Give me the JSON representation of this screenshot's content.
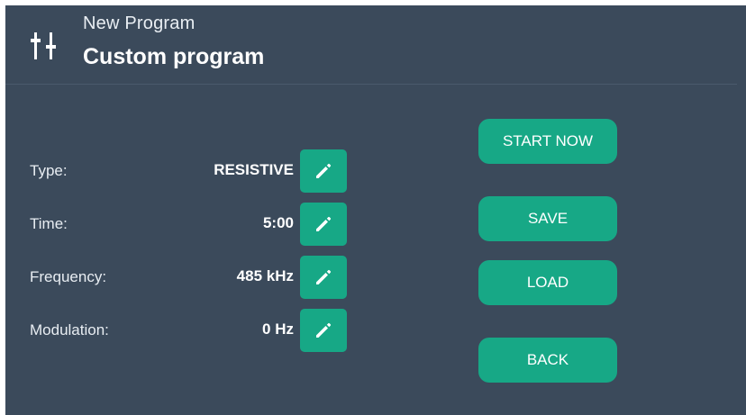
{
  "header": {
    "icon": "equalizer-sliders-icon",
    "subtitle": "New Program",
    "title": "Custom program"
  },
  "settings": [
    {
      "label": "Type:",
      "value": "RESISTIVE",
      "edit_icon": "pencil-icon"
    },
    {
      "label": "Time:",
      "value": "5:00",
      "edit_icon": "pencil-icon"
    },
    {
      "label": "Frequency:",
      "value": "485 kHz",
      "edit_icon": "pencil-icon"
    },
    {
      "label": "Modulation:",
      "value": "0 Hz",
      "edit_icon": "pencil-icon"
    }
  ],
  "actions": {
    "start_now": "START NOW",
    "save": "SAVE",
    "load": "LOAD",
    "back": "BACK"
  },
  "colors": {
    "background": "#3b4a5b",
    "accent": "#17a886",
    "text": "#ffffff"
  }
}
